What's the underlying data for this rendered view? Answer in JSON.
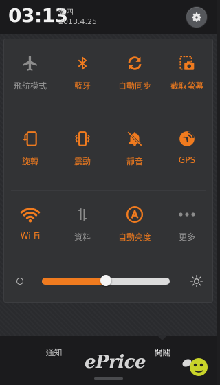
{
  "status": {
    "time": "03:13",
    "weekday": "週四",
    "date": "2013.4.25"
  },
  "toggles": [
    {
      "label": "飛航模式",
      "icon": "airplane-icon",
      "on": false
    },
    {
      "label": "藍牙",
      "icon": "bluetooth-icon",
      "on": true
    },
    {
      "label": "自動同步",
      "icon": "sync-icon",
      "on": true
    },
    {
      "label": "截取螢幕",
      "icon": "screenshot-icon",
      "on": true
    },
    {
      "label": "旋轉",
      "icon": "rotate-icon",
      "on": true
    },
    {
      "label": "震動",
      "icon": "vibrate-icon",
      "on": true
    },
    {
      "label": "靜音",
      "icon": "mute-icon",
      "on": true
    },
    {
      "label": "GPS",
      "icon": "gps-icon",
      "on": true
    },
    {
      "label": "Wi-Fi",
      "icon": "wifi-icon",
      "on": true
    },
    {
      "label": "資料",
      "icon": "data-icon",
      "on": false
    },
    {
      "label": "自動亮度",
      "icon": "auto-brightness-icon",
      "on": true
    },
    {
      "label": "更多",
      "icon": "more-icon",
      "on": false
    }
  ],
  "brightness": {
    "level": 0.5
  },
  "tabs": {
    "notify": "通知",
    "toggles": "開關"
  },
  "watermark": "ePrice",
  "colors": {
    "accent": "#f07b1f",
    "inactive": "#9a9a9a"
  }
}
